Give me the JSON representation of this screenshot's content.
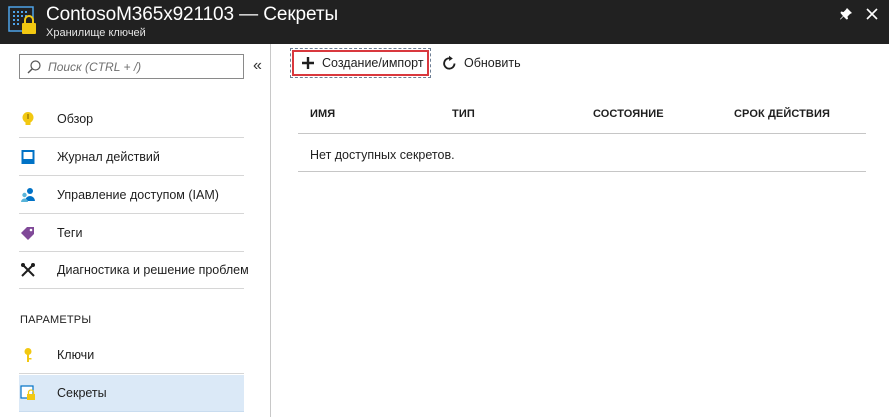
{
  "header": {
    "title": "ContosoM365x921103 — Секреты",
    "subtitle": "Хранилище ключей",
    "icon": "key-vault-icon",
    "pin_icon": "pin-icon",
    "close_icon": "close-icon"
  },
  "sidebar": {
    "search_placeholder": "Поиск (CTRL + /)",
    "collapse_glyph": "«",
    "items": [
      {
        "label": "Обзор",
        "icon": "overview-bulb-icon"
      },
      {
        "label": "Журнал действий",
        "icon": "activity-log-icon"
      },
      {
        "label": "Управление доступом (IAM)",
        "icon": "iam-users-icon"
      },
      {
        "label": "Теги",
        "icon": "tag-icon"
      },
      {
        "label": "Диагностика и решение проблем",
        "icon": "wrench-icon"
      }
    ],
    "section_label": "ПАРАМЕТРЫ",
    "settings_items": [
      {
        "label": "Ключи",
        "icon": "key-icon"
      },
      {
        "label": "Секреты",
        "icon": "secrets-icon",
        "active": true
      }
    ]
  },
  "toolbar": {
    "create_label": "Создание/импорт",
    "refresh_label": "Обновить"
  },
  "table": {
    "columns": [
      "ИМЯ",
      "ТИП",
      "СОСТОЯНИЕ",
      "СРОК ДЕЙСТВИЯ"
    ],
    "empty_message": "Нет доступных секретов."
  },
  "colors": {
    "header_bg": "#212121",
    "active_item_bg": "#dbe9f7",
    "highlight_border": "#d9383e"
  }
}
